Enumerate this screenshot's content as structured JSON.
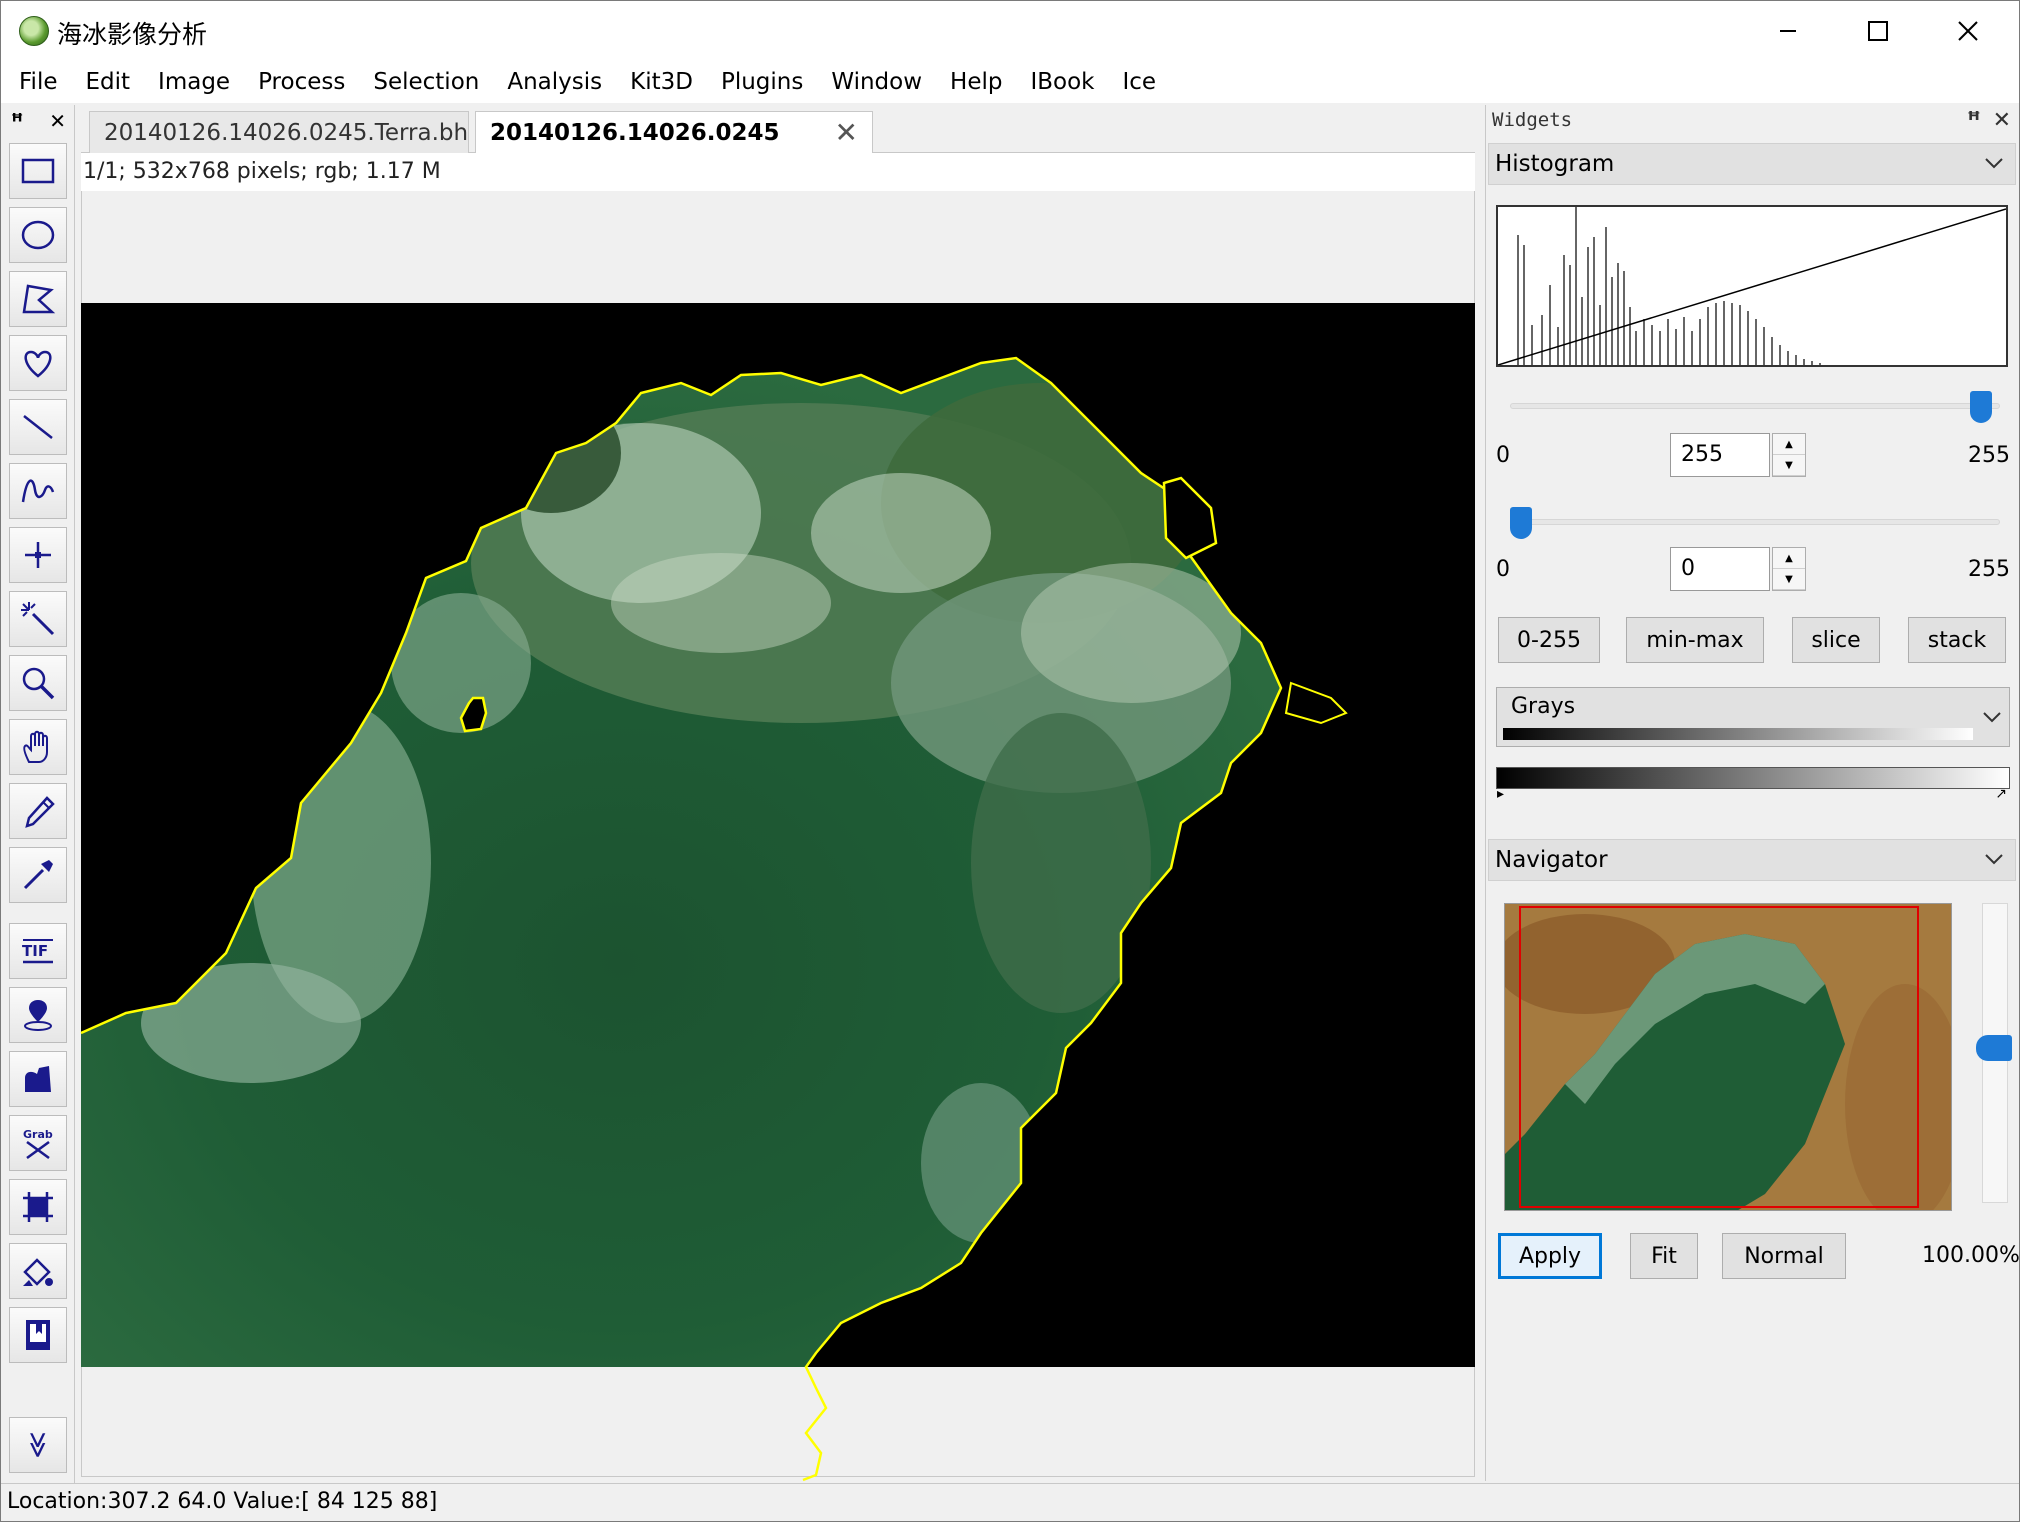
{
  "app": {
    "title": "海冰影像分析"
  },
  "menu": [
    "File",
    "Edit",
    "Image",
    "Process",
    "Selection",
    "Analysis",
    "Kit3D",
    "Plugins",
    "Window",
    "Help",
    "IBook",
    "Ice"
  ],
  "toolbar": {
    "pin": "ꟸ",
    "close": "✕",
    "tools": [
      "rectangle-select",
      "oval-select",
      "polygon-select",
      "freehand-select",
      "line",
      "freeline",
      "point",
      "wand",
      "magnifier",
      "hand",
      "pencil",
      "dropper",
      "tif-export",
      "map-pin",
      "shape-fill",
      "grab",
      "crop-select",
      "paint-bucket",
      "book",
      "more"
    ],
    "more_label": "≫"
  },
  "tabs": [
    {
      "label": "20140126.14026.0245.Terra.bh",
      "active": false
    },
    {
      "label": "20140126.14026.0245",
      "active": true,
      "close": "✕"
    }
  ],
  "doc_info": "1/1;   532x768 pixels; rgb; 1.17 M",
  "widgets": {
    "title": "Widgets",
    "histogram": {
      "title": "Histogram",
      "max_slider_value": "255",
      "max_min_label": "0",
      "max_max_label": "255",
      "min_slider_value": "0",
      "min_min_label": "0",
      "min_max_label": "255",
      "buttons": [
        "0-255",
        "min-max",
        "slice",
        "stack"
      ],
      "lut_name": "Grays",
      "lut_start_mark": "▸",
      "lut_end_mark": "↗"
    },
    "navigator": {
      "title": "Navigator",
      "buttons": {
        "apply": "Apply",
        "fit": "Fit",
        "normal": "Normal"
      },
      "zoom": "100.00%"
    }
  },
  "status": {
    "location": "Location:307.2 64.0  Value:[ 84 125  88]"
  },
  "colors": {
    "selection_outline": "#ffff00",
    "accent": "#1e7ad6",
    "sea": "#1f5a34"
  }
}
